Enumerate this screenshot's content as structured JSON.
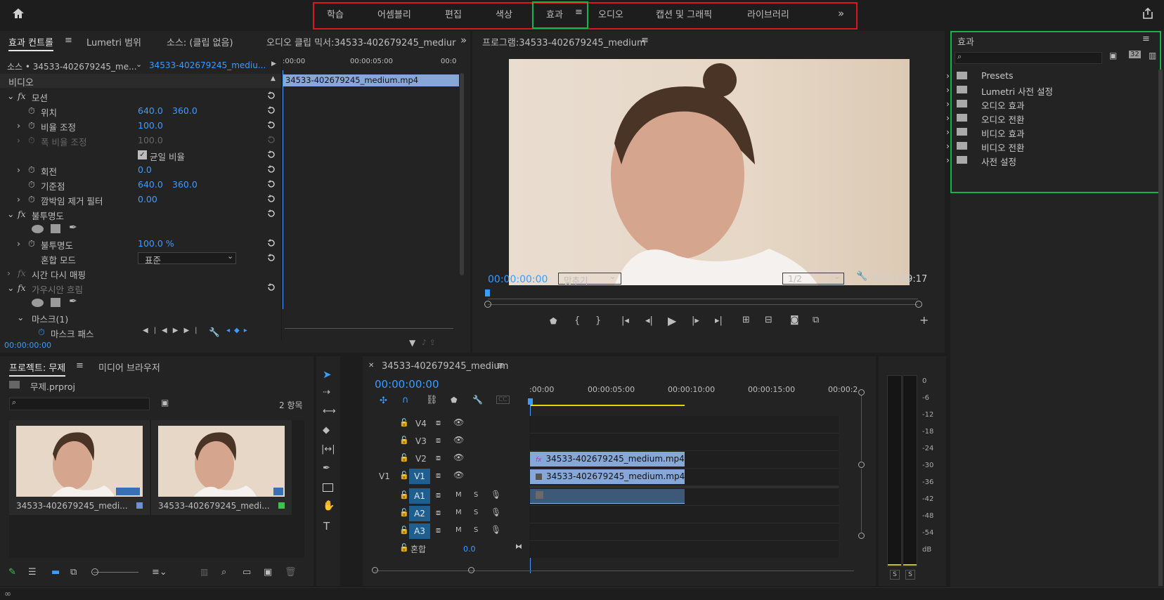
{
  "workspaces": [
    "학습",
    "어셈블리",
    "편집",
    "색상",
    "효과",
    "오디오",
    "캡션 및 그래픽",
    "라이브러리"
  ],
  "workspace_active": "효과",
  "effect_controls": {
    "tabs": [
      "효과 컨트롤",
      "Lumetri 범위",
      "소스: (클립 없음)",
      "오디오 클립 믹서:34533-402679245_mediur"
    ],
    "source_label": "소스 • 34533-402679245_me...",
    "clip_label": "34533-402679245_mediu...",
    "section_video": "비디오",
    "rows": [
      {
        "label": "모션",
        "fx": true
      },
      {
        "label": "위치",
        "v1": "640.0",
        "v2": "360.0"
      },
      {
        "label": "비율 조정",
        "v1": "100.0"
      },
      {
        "label": "폭 비율 조정",
        "v1": "100.0",
        "disabled": true
      },
      {
        "label": "균일 비율"
      },
      {
        "label": "회전",
        "v1": "0.0"
      },
      {
        "label": "기준점",
        "v1": "640.0",
        "v2": "360.0"
      },
      {
        "label": "깜박임 제거 필터",
        "v1": "0.00"
      },
      {
        "label": "불투명도",
        "fx": true
      },
      {
        "label": "불투명도",
        "v1": "100.0 %"
      },
      {
        "label": "혼합 모드",
        "v1": "표준"
      },
      {
        "label": "시간 다시 매핑",
        "fx": true
      },
      {
        "label": "가우시안 흐림",
        "fx": true
      },
      {
        "label": "마스크(1)"
      },
      {
        "label": "마스크 패스"
      }
    ],
    "mini_timecodes": [
      ":00:00",
      "00:00:05:00",
      "00:0"
    ],
    "mini_clip": "34533-402679245_medium.mp4",
    "timecode": "00:00:00:00"
  },
  "program": {
    "title": "프로그램:34533-402679245_medium",
    "timecode": "00:00:00:00",
    "fit": "맞추기",
    "quality": "1/2",
    "duration": "00:00:09:17"
  },
  "effects_panel": {
    "title": "효과",
    "items": [
      "Presets",
      "Lumetri 사전 설정",
      "오디오 효과",
      "오디오 전환",
      "비디오 효과",
      "비디오 전환",
      "사전 설정"
    ]
  },
  "project": {
    "tabs": [
      "프로젝트: 무제",
      "미디어 브라우저"
    ],
    "file": "무제.prproj",
    "count": "2 항목",
    "items": [
      {
        "name": "34533-402679245_medi...",
        "color": "#6f8fcf"
      },
      {
        "name": "34533-402679245_medi...",
        "color": "#3ec24d"
      }
    ]
  },
  "timeline": {
    "tab": "34533-402679245_medium",
    "timecode": "00:00:00:00",
    "ruler": [
      ":00:00",
      "00:00:05:00",
      "00:00:10:00",
      "00:00:15:00",
      "00:00:2"
    ],
    "tracks": [
      "V4",
      "V3",
      "V2",
      "V1",
      "A1",
      "A2",
      "A3"
    ],
    "source_patch": "V1",
    "mix_label": "혼합",
    "mix_value": "0.0",
    "clip_v2": "34533-402679245_medium.mp4",
    "clip_v1": "34533-402679245_medium.mp4 [V]",
    "mute": "M",
    "solo": "S"
  },
  "vu": {
    "ticks": [
      "0",
      "-6",
      "-12",
      "-18",
      "-24",
      "-30",
      "-36",
      "-42",
      "-48",
      "-54",
      "dB"
    ],
    "solo": "S"
  },
  "colors": {
    "accent": "#3a9cff",
    "red_box": "#e0141e",
    "green_box": "#17b34a",
    "clip_blue": "#86a8d8"
  }
}
